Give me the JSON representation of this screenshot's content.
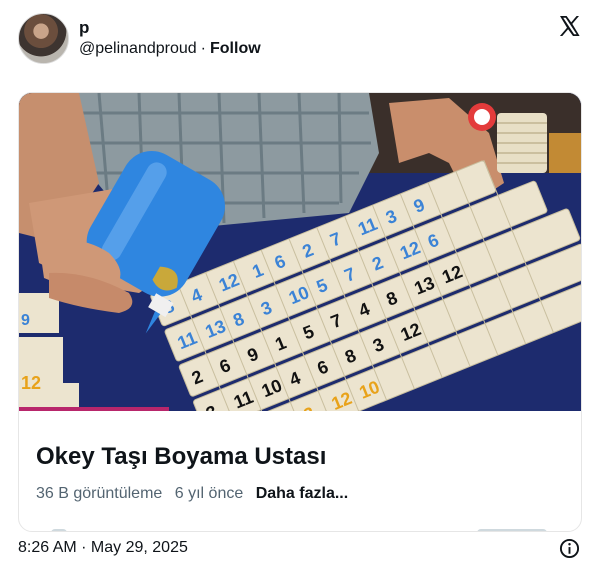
{
  "author": {
    "name": "p",
    "handle": "@pelinandproud",
    "separator": "·",
    "follow_label": "Follow"
  },
  "card": {
    "title": "Okey Taşı Boyama Ustası",
    "views": "36 B görüntüleme",
    "age": "6 yıl önce",
    "more_label": "Daha fazla..."
  },
  "footer": {
    "timestamp": "8:26 AM · May 29, 2025"
  },
  "icons": {
    "brand": "x-logo-icon",
    "info": "info-icon"
  },
  "colors": {
    "text": "#0f1419",
    "muted": "#536471",
    "table_felt": "#1b2a6b",
    "bottle_blue": "#2f86e0"
  }
}
